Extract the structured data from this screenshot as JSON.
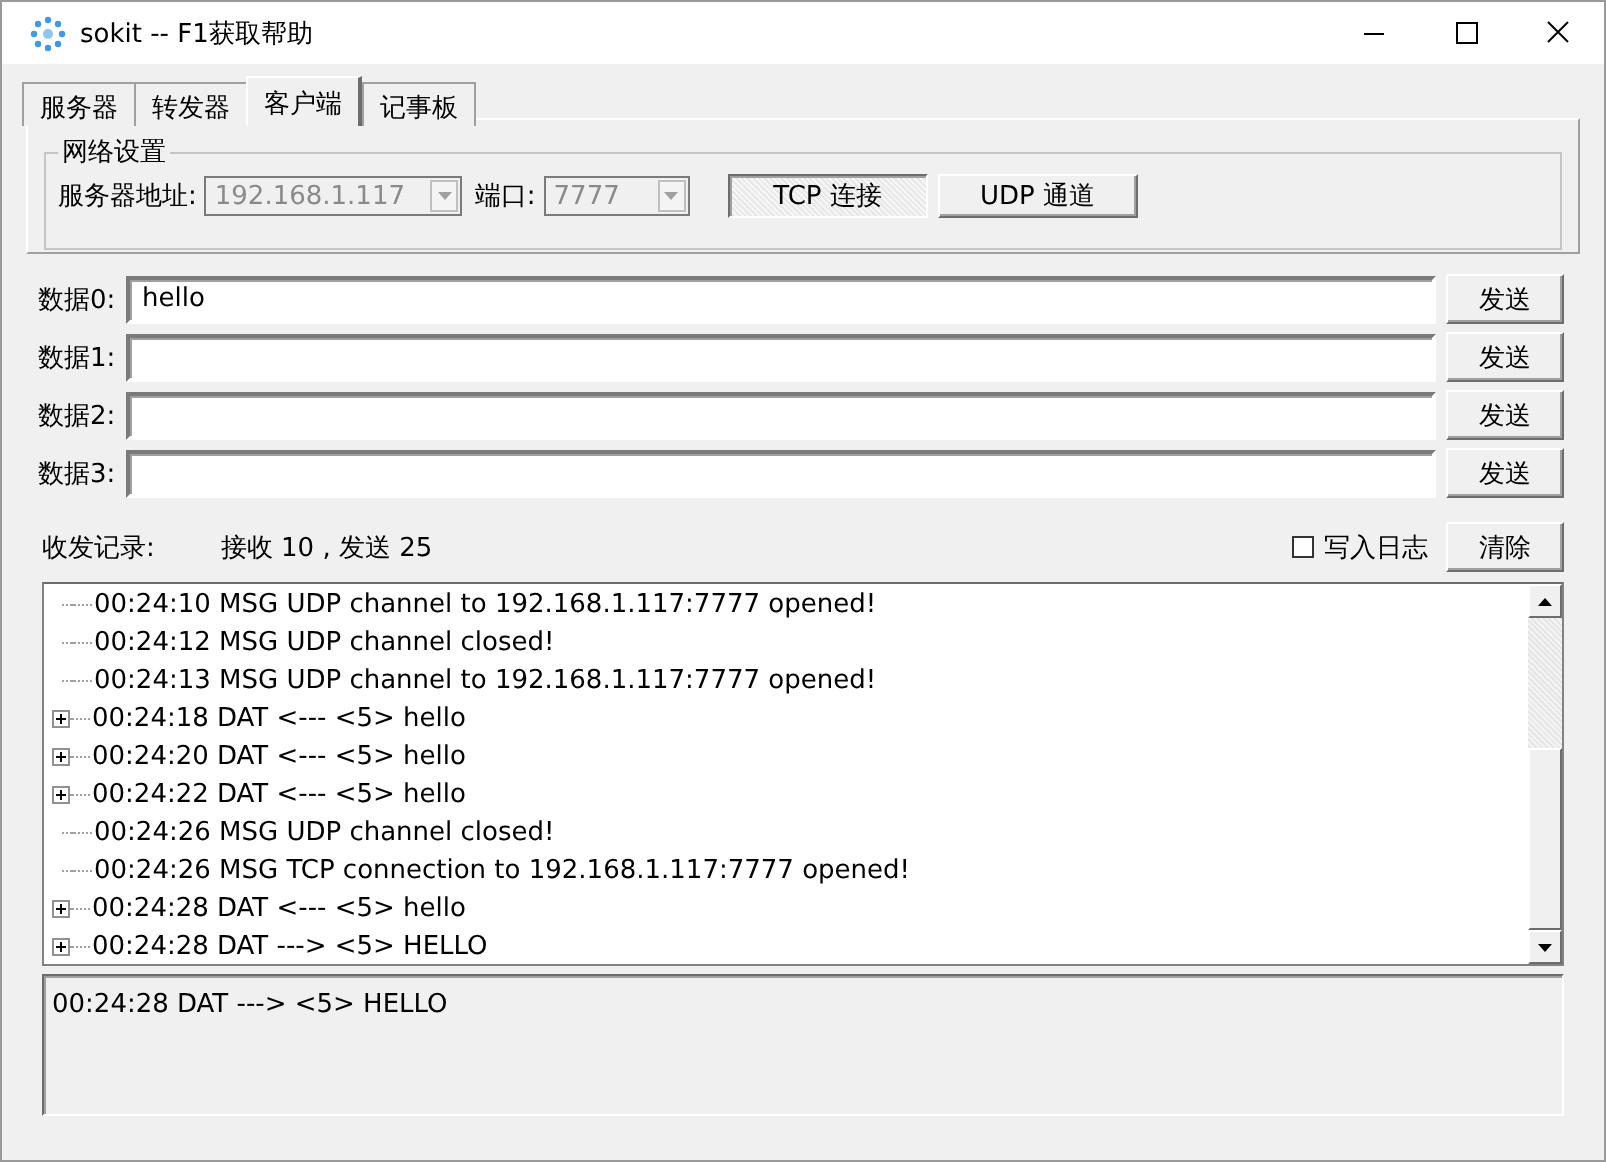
{
  "window": {
    "title": "sokit -- F1获取帮助"
  },
  "tabs": [
    {
      "label": "服务器",
      "selected": false
    },
    {
      "label": "转发器",
      "selected": false
    },
    {
      "label": "客户端",
      "selected": true
    },
    {
      "label": "记事板",
      "selected": false
    }
  ],
  "network_settings": {
    "title": "网络设置",
    "address_label": "服务器地址:",
    "address": {
      "value": "192.168.1.117",
      "disabled": true
    },
    "port_label": "端口:",
    "port": {
      "value": "7777",
      "disabled": true
    },
    "buttons": [
      {
        "label": "TCP 连接",
        "pressed": true
      },
      {
        "label": "UDP 通道",
        "pressed": false
      }
    ]
  },
  "data_rows": [
    {
      "label": "数据0:",
      "value": "hello",
      "button": "发送"
    },
    {
      "label": "数据1:",
      "value": "",
      "button": "发送"
    },
    {
      "label": "数据2:",
      "value": "",
      "button": "发送"
    },
    {
      "label": "数据3:",
      "value": "",
      "button": "发送"
    }
  ],
  "log_header": {
    "label": "收发记录:",
    "counts": "接收 10 , 发送 25",
    "write_log": {
      "label": "写入日志",
      "checked": false
    },
    "clear_button": "清除"
  },
  "log": [
    {
      "text": "00:24:10 MSG UDP channel to 192.168.1.117:7777 opened!",
      "kind": "leaf"
    },
    {
      "text": "00:24:12 MSG UDP channel closed!",
      "kind": "leaf"
    },
    {
      "text": "00:24:13 MSG UDP channel to 192.168.1.117:7777 opened!",
      "kind": "leaf"
    },
    {
      "text": "00:24:18 DAT <--- <5> hello",
      "kind": "node"
    },
    {
      "text": "00:24:20 DAT <--- <5> hello",
      "kind": "node"
    },
    {
      "text": "00:24:22 DAT <--- <5> hello",
      "kind": "node"
    },
    {
      "text": "00:24:26 MSG UDP channel closed!",
      "kind": "leaf"
    },
    {
      "text": "00:24:26 MSG TCP connection to 192.168.1.117:7777 opened!",
      "kind": "leaf"
    },
    {
      "text": "00:24:28 DAT <--- <5> hello",
      "kind": "node"
    },
    {
      "text": "00:24:28 DAT ---> <5> HELLO",
      "kind": "node"
    }
  ],
  "detail": "00:24:28 DAT ---> <5> HELLO"
}
